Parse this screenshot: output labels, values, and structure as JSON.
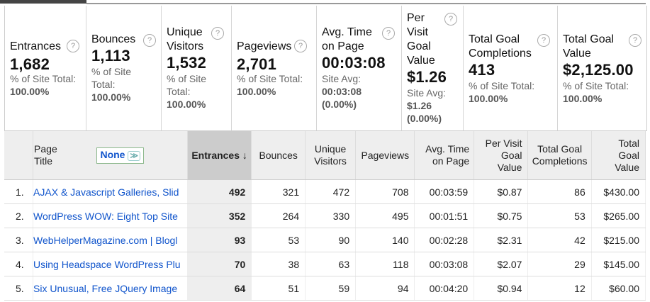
{
  "metrics": [
    {
      "name": "Entrances",
      "value": "1,682",
      "sub": "% of Site Total:",
      "sub_value": "100.00%"
    },
    {
      "name": "Bounces",
      "value": "1,113",
      "sub": "% of Site Total:",
      "sub_value": "100.00%"
    },
    {
      "name": "Unique Visitors",
      "value": "1,532",
      "sub": "% of Site Total:",
      "sub_value": "100.00%"
    },
    {
      "name": "Pageviews",
      "value": "2,701",
      "sub": "% of Site Total:",
      "sub_value": "100.00%"
    },
    {
      "name": "Avg. Time on Page",
      "value": "00:03:08",
      "sub": "Site Avg:",
      "sub_value": "00:03:08 (0.00%)"
    },
    {
      "name": "Per Visit Goal Value",
      "value": "$1.26",
      "sub": "Site Avg:",
      "sub_value": "$1.26 (0.00%)"
    },
    {
      "name": "Total Goal Completions",
      "value": "413",
      "sub": "% of Site Total:",
      "sub_value": "100.00%"
    },
    {
      "name": "Total Goal Value",
      "value": "$2,125.00",
      "sub": "% of Site Total:",
      "sub_value": "100.00%"
    }
  ],
  "help_icon_glyph": "?",
  "table": {
    "headers": {
      "page_title": "Page Title",
      "secondary_dimension": "None",
      "entrances": "Entrances",
      "sort_arrow": "↓",
      "bounces": "Bounces",
      "unique_visitors": "Unique Visitors",
      "pageviews": "Pageviews",
      "avg_time": "Avg. Time on Page",
      "per_visit_goal_value": "Per Visit Goal Value",
      "total_goal_completions": "Total Goal Completions",
      "total_goal_value": "Total Goal Value"
    },
    "rows": [
      {
        "idx": "1.",
        "title": "AJAX & Javascript Galleries, Slid",
        "entrances": "492",
        "bounces": "321",
        "unique": "472",
        "pageviews": "708",
        "avg_time": "00:03:59",
        "pvgv": "$0.87",
        "tgc": "86",
        "tgv": "$430.00"
      },
      {
        "idx": "2.",
        "title": "WordPress WOW: Eight Top Site",
        "entrances": "352",
        "bounces": "264",
        "unique": "330",
        "pageviews": "495",
        "avg_time": "00:01:51",
        "pvgv": "$0.75",
        "tgc": "53",
        "tgv": "$265.00"
      },
      {
        "idx": "3.",
        "title": "WebHelperMagazine.com | Blogl",
        "entrances": "93",
        "bounces": "53",
        "unique": "90",
        "pageviews": "140",
        "avg_time": "00:02:28",
        "pvgv": "$2.31",
        "tgc": "42",
        "tgv": "$215.00"
      },
      {
        "idx": "4.",
        "title": "Using Headspace WordPress Plu",
        "entrances": "70",
        "bounces": "38",
        "unique": "63",
        "pageviews": "118",
        "avg_time": "00:03:08",
        "pvgv": "$2.07",
        "tgc": "29",
        "tgv": "$145.00"
      },
      {
        "idx": "5.",
        "title": "Six Unusual, Free JQuery Image",
        "entrances": "64",
        "bounces": "51",
        "unique": "59",
        "pageviews": "94",
        "avg_time": "00:04:20",
        "pvgv": "$0.94",
        "tgc": "12",
        "tgv": "$60.00"
      }
    ]
  }
}
